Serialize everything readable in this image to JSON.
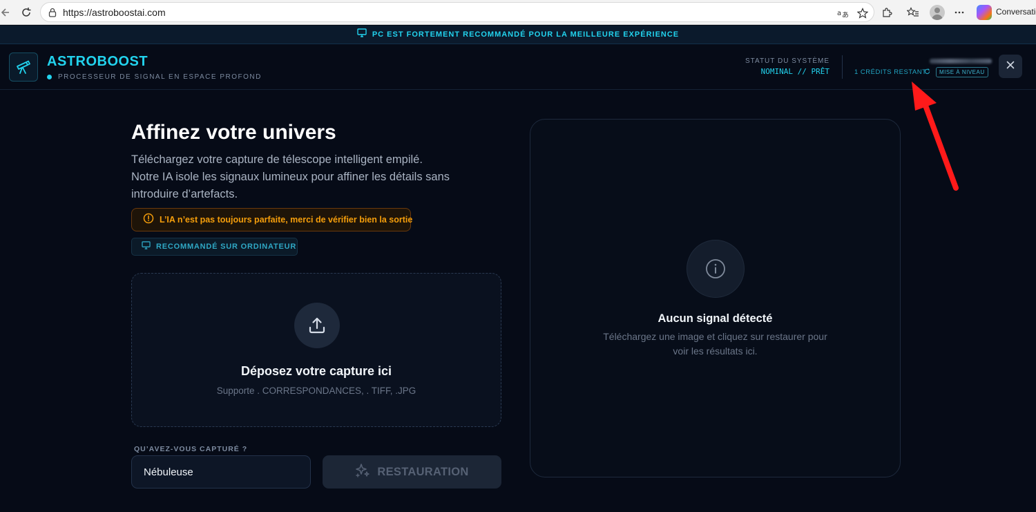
{
  "browser": {
    "url": "https://astroboostai.com",
    "copilot_label": "Conversatio"
  },
  "announcement": {
    "text": "PC EST FORTEMENT RECOMMANDÉ POUR LA MEILLEURE EXPÉRIENCE"
  },
  "header": {
    "brand": "ASTROBOOST",
    "tagline": "PROCESSEUR DE SIGNAL EN ESPACE PROFOND",
    "status_label": "STATUT DU SYSTÈME",
    "status_value": "NOMINAL // PRÊT",
    "credits": "1 CRÉDITS RESTANT",
    "upgrade_label": "MISE À NIVEAU"
  },
  "main": {
    "title": "Affinez votre univers",
    "description_lines": [
      "Téléchargez votre capture de télescope intelligent empilé.",
      "Notre IA isole les signaux lumineux pour affiner les détails sans",
      "introduire d’artefacts."
    ],
    "warning": "L’IA n’est pas toujours parfaite, merci de vérifier bien la sortie",
    "recommend_badge": "RECOMMANDÉ SUR ORDINATEUR",
    "dropzone": {
      "title": "Déposez votre capture ici",
      "subtitle": "Supporte . CORRESPONDANCES, . TIFF, .JPG"
    },
    "capture_label": "QU’AVEZ-VOUS CAPTURÉ ?",
    "capture_value": "Nébuleuse",
    "restore_label": "RESTAURATION"
  },
  "result": {
    "title": "Aucun signal détecté",
    "subtitle": "Téléchargez une image et cliquez sur restaurer pour voir les résultats ici."
  },
  "colors": {
    "accent": "#22d3ee",
    "warning": "#f59e0b",
    "background": "#060b17",
    "annotation_arrow": "#ff1a1a"
  }
}
